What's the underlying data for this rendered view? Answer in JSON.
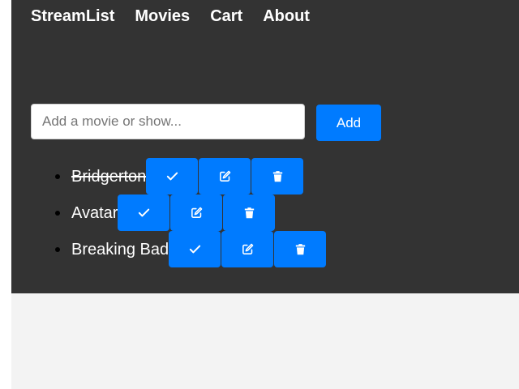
{
  "nav": {
    "items": [
      "StreamList",
      "Movies",
      "Cart",
      "About"
    ]
  },
  "form": {
    "placeholder": "Add a movie or show...",
    "value": "",
    "add_label": "Add"
  },
  "list": {
    "items": [
      {
        "title": "Bridgerton",
        "completed": true
      },
      {
        "title": "Avatar",
        "completed": false
      },
      {
        "title": "Breaking Bad",
        "completed": false
      }
    ]
  },
  "actions": {
    "complete_icon": "check-icon",
    "edit_icon": "edit-icon",
    "delete_icon": "trash-icon"
  },
  "colors": {
    "panel": "#333333",
    "page": "#f3f3f3",
    "accent": "#007bff",
    "text": "#ffffff"
  }
}
